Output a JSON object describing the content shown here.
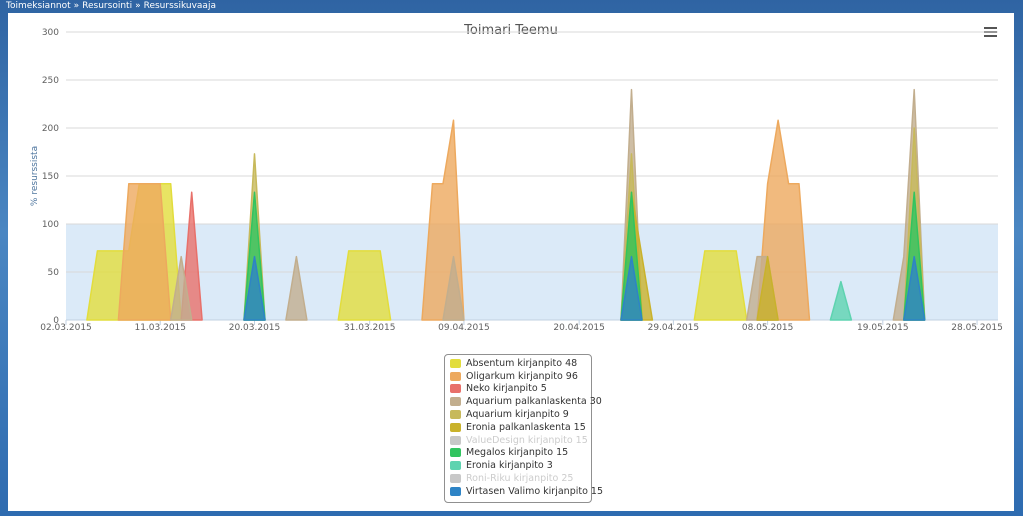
{
  "breadcrumb": [
    "Toimeksiannot",
    "Resursointi",
    "Resurssikuvaaja"
  ],
  "breadcrumb_sep": "»",
  "menu_icon": "hamburger-menu-icon",
  "chart_data": {
    "type": "area",
    "title": "Toimari Teemu",
    "ylabel": "% resurssista",
    "xlabel": "",
    "ylim": [
      0,
      300
    ],
    "yticks": [
      0,
      50,
      100,
      150,
      200,
      250,
      300
    ],
    "x_range": [
      "2015-03-02",
      "2015-05-30"
    ],
    "xticks": [
      "02.03.2015",
      "11.03.2015",
      "20.03.2015",
      "31.03.2015",
      "09.04.2015",
      "20.04.2015",
      "29.04.2015",
      "08.05.2015",
      "19.05.2015",
      "28.05.2015"
    ],
    "plot_band": {
      "from": 0,
      "to": 100,
      "color": "#dbeaf8"
    },
    "grid": true,
    "legend_position": "bottom-center",
    "series": [
      {
        "name": "Absentum kirjanpito 48",
        "color": "#e2dd3c",
        "visible": true,
        "points": [
          [
            "2015-03-04",
            0
          ],
          [
            "2015-03-05",
            72
          ],
          [
            "2015-03-08",
            72
          ],
          [
            "2015-03-09",
            142
          ],
          [
            "2015-03-12",
            142
          ],
          [
            "2015-03-13",
            0
          ],
          [
            "2015-03-28",
            0
          ],
          [
            "2015-03-29",
            72
          ],
          [
            "2015-04-01",
            72
          ],
          [
            "2015-04-02",
            0
          ],
          [
            "2015-05-01",
            0
          ],
          [
            "2015-05-02",
            72
          ],
          [
            "2015-05-05",
            72
          ],
          [
            "2015-05-06",
            0
          ]
        ]
      },
      {
        "name": "Oligarkum kirjanpito 96",
        "color": "#eda95e",
        "visible": true,
        "points": [
          [
            "2015-03-07",
            0
          ],
          [
            "2015-03-08",
            142
          ],
          [
            "2015-03-11",
            142
          ],
          [
            "2015-03-12",
            0
          ],
          [
            "2015-04-05",
            0
          ],
          [
            "2015-04-06",
            142
          ],
          [
            "2015-04-07",
            142
          ],
          [
            "2015-04-08",
            208
          ],
          [
            "2015-04-09",
            0
          ],
          [
            "2015-05-07",
            0
          ],
          [
            "2015-05-08",
            142
          ],
          [
            "2015-05-09",
            208
          ],
          [
            "2015-05-10",
            142
          ],
          [
            "2015-05-11",
            142
          ],
          [
            "2015-05-12",
            0
          ]
        ]
      },
      {
        "name": "Neko kirjanpito 5",
        "color": "#e8706a",
        "visible": true,
        "points": [
          [
            "2015-03-13",
            0
          ],
          [
            "2015-03-14",
            133
          ],
          [
            "2015-03-15",
            0
          ]
        ]
      },
      {
        "name": "Aquarium palkanlaskenta 30",
        "color": "#c2ae8e",
        "visible": true,
        "points": [
          [
            "2015-03-12",
            0
          ],
          [
            "2015-03-13",
            66
          ],
          [
            "2015-03-14",
            0
          ],
          [
            "2015-03-23",
            0
          ],
          [
            "2015-03-24",
            66
          ],
          [
            "2015-03-25",
            0
          ],
          [
            "2015-04-07",
            0
          ],
          [
            "2015-04-08",
            66
          ],
          [
            "2015-04-09",
            0
          ],
          [
            "2015-04-24",
            0
          ],
          [
            "2015-04-25",
            240
          ],
          [
            "2015-04-26",
            0
          ],
          [
            "2015-05-06",
            0
          ],
          [
            "2015-05-07",
            66
          ],
          [
            "2015-05-08",
            66
          ],
          [
            "2015-05-09",
            0
          ],
          [
            "2015-05-20",
            0
          ],
          [
            "2015-05-21",
            66
          ],
          [
            "2015-05-22",
            240
          ],
          [
            "2015-05-23",
            0
          ]
        ]
      },
      {
        "name": "Aquarium kirjanpito 9",
        "color": "#c7b95b",
        "visible": true,
        "points": [
          [
            "2015-03-19",
            0
          ],
          [
            "2015-03-20",
            173
          ],
          [
            "2015-03-21",
            0
          ],
          [
            "2015-04-24",
            0
          ],
          [
            "2015-04-25",
            173
          ],
          [
            "2015-04-26",
            0
          ],
          [
            "2015-05-21",
            0
          ],
          [
            "2015-05-22",
            200
          ],
          [
            "2015-05-23",
            0
          ]
        ]
      },
      {
        "name": "Eronia palkanlaskenta 15",
        "color": "#c9b22b",
        "visible": true,
        "points": [
          [
            "2015-04-24",
            0
          ],
          [
            "2015-04-25",
            133
          ],
          [
            "2015-04-26",
            66
          ],
          [
            "2015-04-27",
            0
          ],
          [
            "2015-05-07",
            0
          ],
          [
            "2015-05-08",
            66
          ],
          [
            "2015-05-09",
            0
          ]
        ]
      },
      {
        "name": "ValueDesign kirjanpito 15",
        "color": "#c8c8c8",
        "visible": false,
        "points": []
      },
      {
        "name": "Megalos kirjanpito 15",
        "color": "#31c45f",
        "visible": true,
        "points": [
          [
            "2015-03-19",
            0
          ],
          [
            "2015-03-20",
            133
          ],
          [
            "2015-03-21",
            0
          ],
          [
            "2015-04-24",
            0
          ],
          [
            "2015-04-25",
            133
          ],
          [
            "2015-04-26",
            0
          ],
          [
            "2015-05-21",
            0
          ],
          [
            "2015-05-22",
            133
          ],
          [
            "2015-05-23",
            0
          ]
        ]
      },
      {
        "name": "Eronia kirjanpito 3",
        "color": "#5ed3b0",
        "visible": true,
        "points": [
          [
            "2015-05-14",
            0
          ],
          [
            "2015-05-15",
            40
          ],
          [
            "2015-05-16",
            0
          ]
        ]
      },
      {
        "name": "Roni-Riku kirjanpito 25",
        "color": "#c8c8c8",
        "visible": false,
        "points": []
      },
      {
        "name": "Virtasen Valimo kirjanpito 15",
        "color": "#2e84c6",
        "visible": true,
        "points": [
          [
            "2015-03-19",
            0
          ],
          [
            "2015-03-20",
            66
          ],
          [
            "2015-03-21",
            0
          ],
          [
            "2015-04-24",
            0
          ],
          [
            "2015-04-25",
            66
          ],
          [
            "2015-04-26",
            0
          ],
          [
            "2015-05-21",
            0
          ],
          [
            "2015-05-22",
            66
          ],
          [
            "2015-05-23",
            0
          ]
        ]
      }
    ]
  }
}
